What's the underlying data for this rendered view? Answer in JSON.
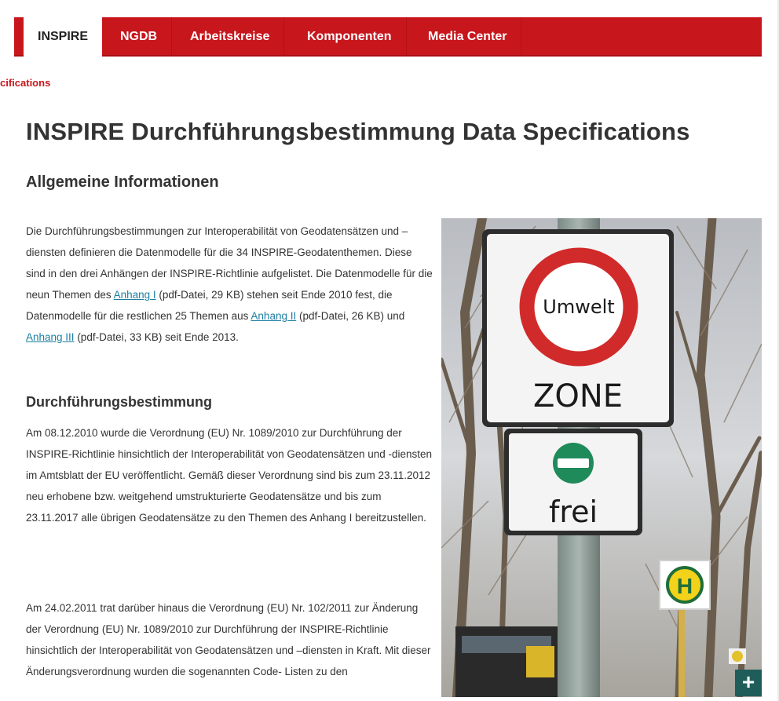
{
  "nav": {
    "items": [
      {
        "label": "INSPIRE",
        "active": true
      },
      {
        "label": "NGDB",
        "active": false
      },
      {
        "label": "Arbeitskreise",
        "active": false
      },
      {
        "label": "Komponenten",
        "active": false
      },
      {
        "label": "Media Center",
        "active": false
      }
    ]
  },
  "breadcrumb": "cifications",
  "page_title": "INSPIRE Durchführungsbestimmung Data Specifications",
  "section_general": {
    "heading": "Allgemeine Informationen",
    "text_1": "Die Durchführungsbestimmungen zur Interoperabilität von Geodatensätzen und –diensten definieren die Datenmodelle für die 34 INSPIRE-Geodatenthemen. Diese sind in den drei Anhängen der INSPIRE-Richtlinie aufgelistet. Die Datenmodelle für die neun Themen des ",
    "link_1": "Anhang I",
    "text_2": " (pdf-Datei, 29 KB) stehen seit Ende 2010 fest, die Datenmodelle für die restlichen 25 Themen aus ",
    "link_2": "Anhang II",
    "text_3": " (pdf-Datei, 26 KB) und ",
    "link_3": "Anhang III",
    "text_4": " (pdf-Datei, 33 KB) seit Ende 2013."
  },
  "section_implementation": {
    "heading": "Durchführungsbestimmung",
    "paragraph_1": "Am 08.12.2010 wurde die Verordnung (EU) Nr. 1089/2010 zur Durchführung der INSPIRE-Richtlinie hinsichtlich der Interoperabilität von Geodatensätzen und -diensten im Amtsblatt der EU veröffentlicht. Gemäß dieser Verordnung sind bis zum 23.11.2012 neu erhobene bzw. weitgehend umstrukturierte Geodatensätze und bis zum 23.11.2017 alle übrigen Geodatensätze zu den Themen des Anhang I bereitzustellen.",
    "paragraph_2": "Am 24.02.2011 trat darüber hinaus die Verordnung (EU) Nr. 102/2011 zur Änderung der Verordnung (EU) Nr. 1089/2010 zur Durchführung der INSPIRE-Richtlinie hinsichtlich der Interoperabilität von Geodatensätzen und –diensten in Kraft. Mit dieser Änderungsverordnung wurden die sogenannten Code- Listen zu den"
  },
  "photo": {
    "sign_top_word": "Umwelt",
    "sign_main_word": "ZONE",
    "sign_sub_word": "frei",
    "bus_stop_letter": "H",
    "expand_label": "+"
  },
  "colors": {
    "nav_red": "#c8161d",
    "link": "#1d7fa3",
    "expand_button": "#1f5d5a"
  }
}
